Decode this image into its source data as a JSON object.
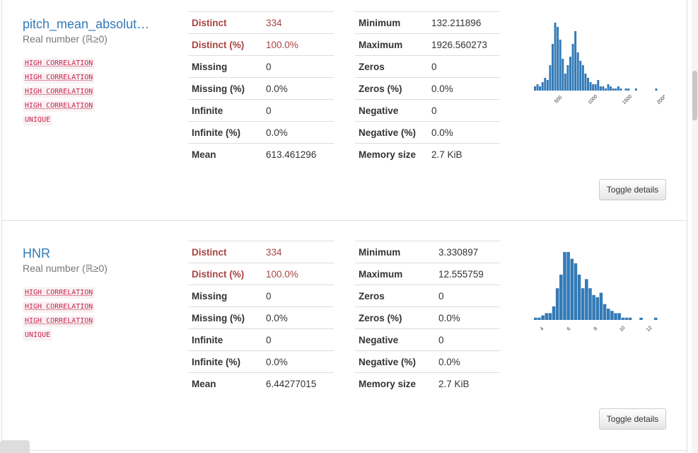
{
  "variables": [
    {
      "name": "pitch_mean_absolut…",
      "type": "Real number (ℝ≥0)",
      "tags": [
        "HIGH CORRELATION",
        "HIGH CORRELATION",
        "HIGH CORRELATION",
        "HIGH CORRELATION",
        "UNIQUE"
      ],
      "stats_left": [
        {
          "k": "Distinct",
          "v": "334"
        },
        {
          "k": "Distinct (%)",
          "v": "100.0%"
        },
        {
          "k": "Missing",
          "v": "0"
        },
        {
          "k": "Missing (%)",
          "v": "0.0%"
        },
        {
          "k": "Infinite",
          "v": "0"
        },
        {
          "k": "Infinite (%)",
          "v": "0.0%"
        },
        {
          "k": "Mean",
          "v": "613.461296"
        }
      ],
      "stats_right": [
        {
          "k": "Minimum",
          "v": "132.211896"
        },
        {
          "k": "Maximum",
          "v": "1926.560273"
        },
        {
          "k": "Zeros",
          "v": "0"
        },
        {
          "k": "Zeros (%)",
          "v": "0.0%"
        },
        {
          "k": "Negative",
          "v": "0"
        },
        {
          "k": "Negative (%)",
          "v": "0.0%"
        },
        {
          "k": "Memory size",
          "v": "2.7 KiB"
        }
      ],
      "toggle_label": "Toggle details"
    },
    {
      "name": "HNR",
      "type": "Real number (ℝ≥0)",
      "tags": [
        "HIGH CORRELATION",
        "HIGH CORRELATION",
        "HIGH CORRELATION",
        "UNIQUE"
      ],
      "stats_left": [
        {
          "k": "Distinct",
          "v": "334"
        },
        {
          "k": "Distinct (%)",
          "v": "100.0%"
        },
        {
          "k": "Missing",
          "v": "0"
        },
        {
          "k": "Missing (%)",
          "v": "0.0%"
        },
        {
          "k": "Infinite",
          "v": "0"
        },
        {
          "k": "Infinite (%)",
          "v": "0.0%"
        },
        {
          "k": "Mean",
          "v": "6.44277015"
        }
      ],
      "stats_right": [
        {
          "k": "Minimum",
          "v": "3.330897"
        },
        {
          "k": "Maximum",
          "v": "12.555759"
        },
        {
          "k": "Zeros",
          "v": "0"
        },
        {
          "k": "Zeros (%)",
          "v": "0.0%"
        },
        {
          "k": "Negative",
          "v": "0"
        },
        {
          "k": "Negative (%)",
          "v": "0.0%"
        },
        {
          "k": "Memory size",
          "v": "2.7 KiB"
        }
      ],
      "toggle_label": "Toggle details"
    }
  ],
  "chart_data": [
    {
      "type": "bar",
      "x_range": [
        132,
        1927
      ],
      "xticks": [
        "500",
        "1000",
        "1500",
        "2000"
      ],
      "xtick_values": [
        500,
        1000,
        1500,
        2000
      ],
      "bar_color": "#337ab7",
      "values": [
        2,
        3,
        2,
        4,
        6,
        5,
        12,
        22,
        32,
        30,
        24,
        15,
        8,
        12,
        16,
        22,
        28,
        18,
        14,
        12,
        8,
        6,
        4,
        3,
        3,
        5,
        2,
        2,
        1,
        3,
        2,
        1,
        1,
        2,
        1,
        0,
        1,
        1,
        0,
        0,
        1,
        0,
        0,
        0,
        0,
        0,
        0,
        0,
        1
      ],
      "grid": false,
      "legend": "none"
    },
    {
      "type": "bar",
      "x_range": [
        3.33,
        12.56
      ],
      "xticks": [
        "4",
        "6",
        "8",
        "10",
        "12"
      ],
      "xtick_values": [
        4,
        6,
        8,
        10,
        12
      ],
      "bar_color": "#337ab7",
      "values": [
        1,
        1,
        2,
        3,
        3,
        6,
        14,
        20,
        30,
        30,
        27,
        25,
        20,
        14,
        18,
        14,
        11,
        10,
        12,
        7,
        5,
        4,
        3,
        3,
        1,
        1,
        1,
        0,
        0,
        1,
        0,
        0,
        0,
        1
      ],
      "grid": false,
      "legend": "none"
    }
  ]
}
